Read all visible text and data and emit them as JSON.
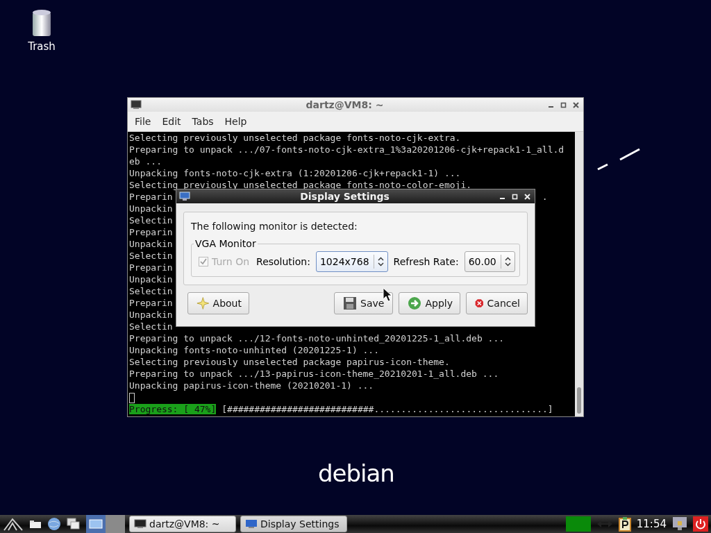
{
  "desktop": {
    "icons": [
      {
        "label": "Trash"
      }
    ],
    "logo_text": "debian"
  },
  "terminal": {
    "title": "dartz@VM8: ~",
    "menu": [
      "File",
      "Edit",
      "Tabs",
      "Help"
    ],
    "lines": [
      "Selecting previously unselected package fonts-noto-cjk-extra.",
      "Preparing to unpack .../07-fonts-noto-cjk-extra_1%3a20201206-cjk+repack1-1_all.d",
      "eb ...",
      "Unpacking fonts-noto-cjk-extra (1:20201206-cjk+repack1-1) ...",
      "Selecting previously unselected package fonts-noto-color-emoji.",
      [
        "Preparin",
        "."
      ],
      "Unpackin",
      "Selectin",
      "Preparin",
      "Unpackin",
      "Selectin",
      "Preparin",
      "Unpackin",
      "Selectin",
      "Preparin",
      "Unpackin",
      "Selectin",
      "Preparing to unpack .../12-fonts-noto-unhinted_20201225-1_all.deb ...",
      "Unpacking fonts-noto-unhinted (20201225-1) ...",
      "Selecting previously unselected package papirus-icon-theme.",
      "Preparing to unpack .../13-papirus-icon-theme_20210201-1_all.deb ...",
      "Unpacking papirus-icon-theme (20210201-1) ..."
    ],
    "progress": {
      "label": "Progress: [ 47%]",
      "bar": "[###########################................................]"
    }
  },
  "dialog": {
    "title": "Display Settings",
    "message": "The following monitor is detected:",
    "group_label": "VGA Monitor",
    "turn_on": {
      "label": "Turn On",
      "checked": true,
      "disabled": true
    },
    "resolution": {
      "label": "Resolution:",
      "value": "1024x768"
    },
    "refresh_rate": {
      "label": "Refresh Rate:",
      "value": "60.00"
    },
    "buttons": [
      {
        "label": "About",
        "kind": "about"
      },
      {
        "label": "Save",
        "kind": "save"
      },
      {
        "label": "Apply",
        "kind": "apply"
      },
      {
        "label": "Cancel",
        "kind": "cancel"
      }
    ]
  },
  "taskbar": {
    "tasks": [
      {
        "label": "dartz@VM8: ~",
        "kind": "terminal",
        "selected": false
      },
      {
        "label": "Display Settings",
        "kind": "display",
        "selected": true
      }
    ],
    "clock": "11:54"
  }
}
